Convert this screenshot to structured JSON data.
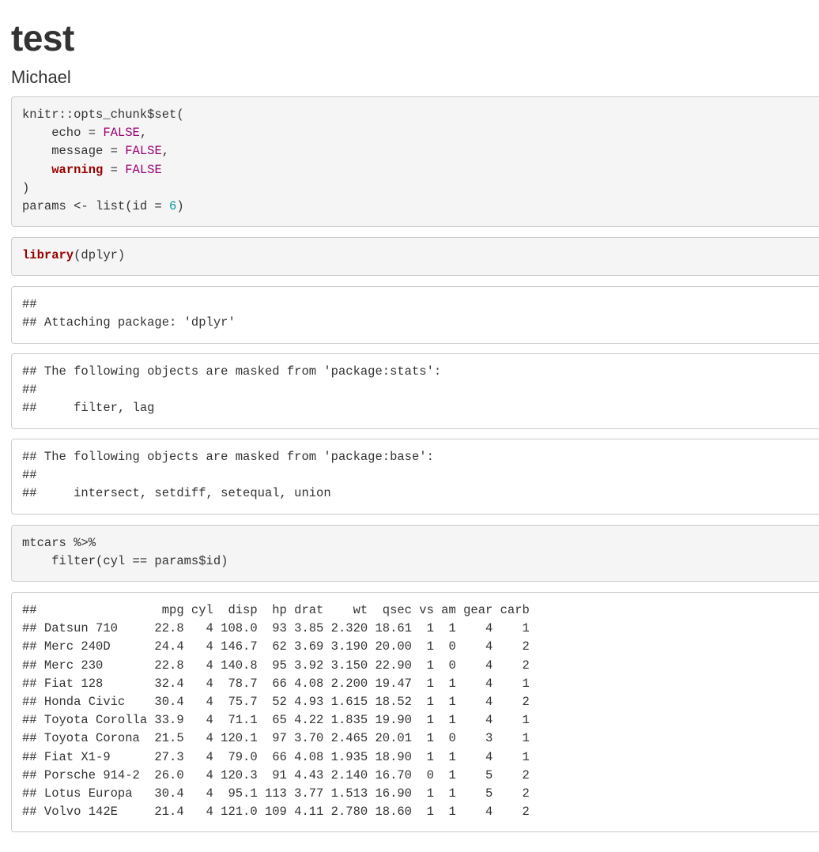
{
  "document": {
    "title": "test",
    "author": "Michael"
  },
  "chunks": [
    {
      "kind": "source",
      "lines": [
        [
          {
            "t": "knitr::opts_chunk$set("
          }
        ],
        [
          {
            "t": "    echo = "
          },
          {
            "t": "FALSE",
            "c": "bool"
          },
          {
            "t": ","
          }
        ],
        [
          {
            "t": "    message = "
          },
          {
            "t": "FALSE",
            "c": "bool"
          },
          {
            "t": ","
          }
        ],
        [
          {
            "t": "    "
          },
          {
            "t": "warning",
            "c": "kw"
          },
          {
            "t": " = "
          },
          {
            "t": "FALSE",
            "c": "bool"
          }
        ],
        [
          {
            "t": ")"
          }
        ],
        [
          {
            "t": "params <- list(id = "
          },
          {
            "t": "6",
            "c": "num"
          },
          {
            "t": ")"
          }
        ]
      ]
    },
    {
      "kind": "source",
      "lines": [
        [
          {
            "t": "library",
            "c": "kw"
          },
          {
            "t": "(dplyr)"
          }
        ]
      ]
    },
    {
      "kind": "output",
      "lines": [
        [
          {
            "t": "##"
          }
        ],
        [
          {
            "t": "## Attaching package: 'dplyr'"
          }
        ]
      ]
    },
    {
      "kind": "output",
      "lines": [
        [
          {
            "t": "## The following objects are masked from 'package:stats':"
          }
        ],
        [
          {
            "t": "##"
          }
        ],
        [
          {
            "t": "##     filter, lag"
          }
        ]
      ]
    },
    {
      "kind": "output",
      "lines": [
        [
          {
            "t": "## The following objects are masked from 'package:base':"
          }
        ],
        [
          {
            "t": "##"
          }
        ],
        [
          {
            "t": "##     intersect, setdiff, setequal, union"
          }
        ]
      ]
    },
    {
      "kind": "source",
      "lines": [
        [
          {
            "t": "mtcars %>%"
          }
        ],
        [
          {
            "t": "    filter(cyl == params$id)"
          }
        ]
      ]
    },
    {
      "kind": "output",
      "lines": [
        [
          {
            "t": "##                 mpg cyl  disp  hp drat    wt  qsec vs am gear carb"
          }
        ],
        [
          {
            "t": "## Datsun 710     22.8   4 108.0  93 3.85 2.320 18.61  1  1    4    1"
          }
        ],
        [
          {
            "t": "## Merc 240D      24.4   4 146.7  62 3.69 3.190 20.00  1  0    4    2"
          }
        ],
        [
          {
            "t": "## Merc 230       22.8   4 140.8  95 3.92 3.150 22.90  1  0    4    2"
          }
        ],
        [
          {
            "t": "## Fiat 128       32.4   4  78.7  66 4.08 2.200 19.47  1  1    4    1"
          }
        ],
        [
          {
            "t": "## Honda Civic    30.4   4  75.7  52 4.93 1.615 18.52  1  1    4    2"
          }
        ],
        [
          {
            "t": "## Toyota Corolla 33.9   4  71.1  65 4.22 1.835 19.90  1  1    4    1"
          }
        ],
        [
          {
            "t": "## Toyota Corona  21.5   4 120.1  97 3.70 2.465 20.01  1  0    3    1"
          }
        ],
        [
          {
            "t": "## Fiat X1-9      27.3   4  79.0  66 4.08 1.935 18.90  1  1    4    1"
          }
        ],
        [
          {
            "t": "## Porsche 914-2  26.0   4 120.3  91 4.43 2.140 16.70  0  1    5    2"
          }
        ],
        [
          {
            "t": "## Lotus Europa   30.4   4  95.1 113 3.77 1.513 16.90  1  1    5    2"
          }
        ],
        [
          {
            "t": "## Volvo 142E     21.4   4 121.0 109 4.11 2.780 18.60  1  1    4    2"
          }
        ]
      ]
    }
  ]
}
